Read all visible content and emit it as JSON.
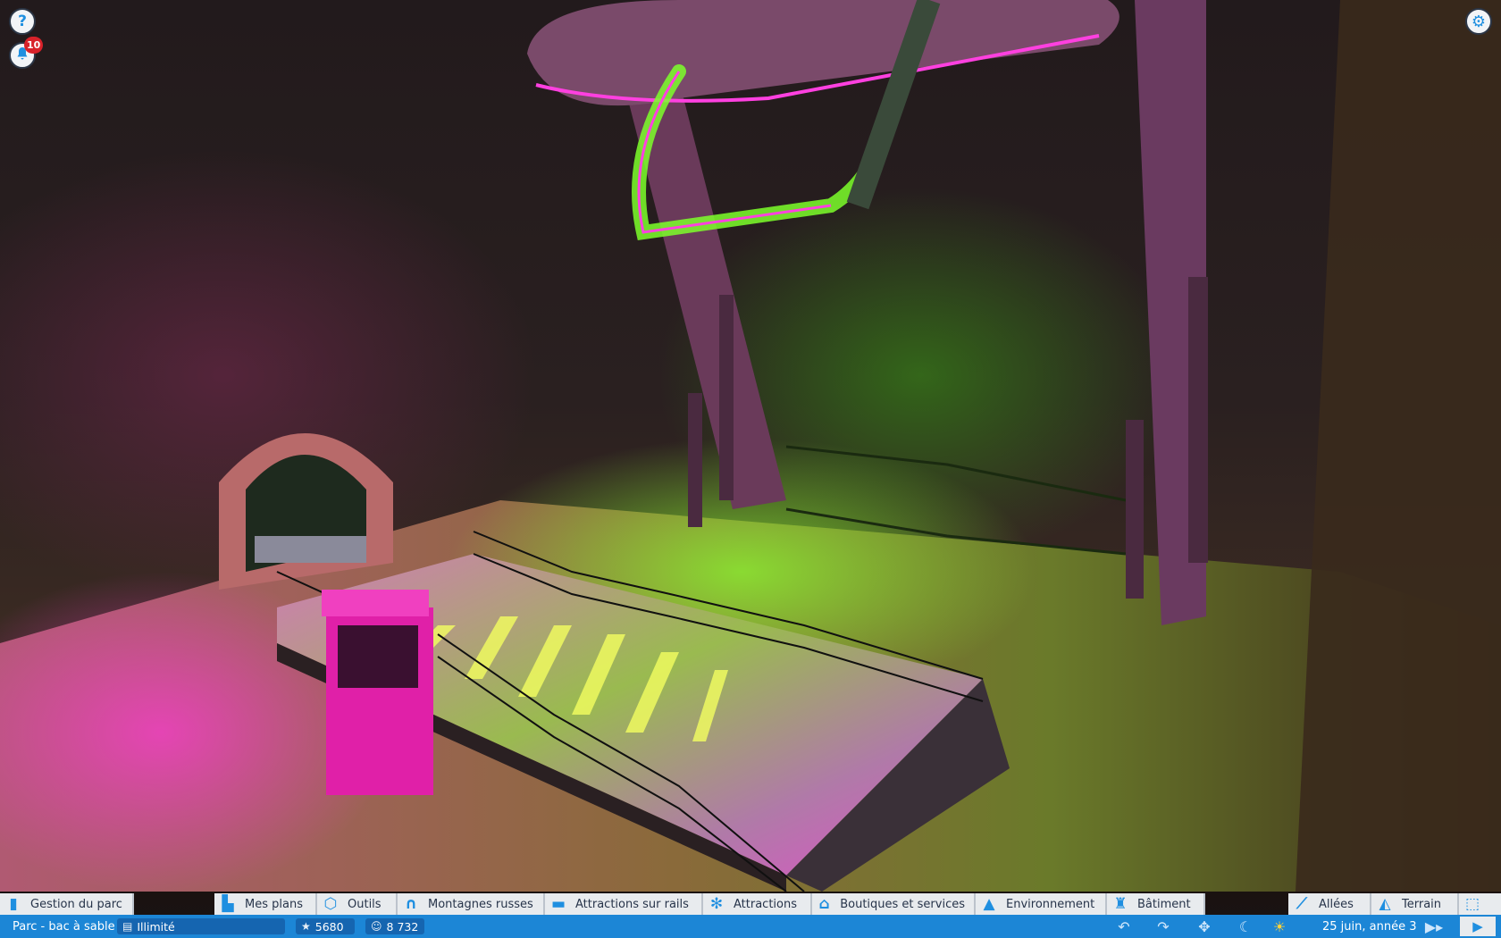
{
  "hud": {
    "help_icon": "question-icon",
    "notifications_icon": "bell-icon",
    "notification_count": "10",
    "settings_icon": "gear-icon"
  },
  "toolbar": {
    "park_management": "Gestion du parc",
    "blueprints": "Mes plans",
    "tools": "Outils",
    "coasters": "Montagnes russes",
    "track_rides": "Attractions sur rails",
    "flat_rides": "Attractions",
    "shops": "Boutiques et services",
    "scenery": "Environnement",
    "building": "Bâtiment",
    "paths": "Allées",
    "terrain": "Terrain"
  },
  "status": {
    "park_name": "Parc - bac à sable",
    "money": "Illimité",
    "rating": "5680",
    "guests": "8 732",
    "date": "25 juin, année 3"
  },
  "colors": {
    "toolbar_bg": "#e8ebee",
    "status_bg": "#1c86d6",
    "accent": "#1f8fe0",
    "badge": "#d8222a",
    "neon_green": "#7cff2a",
    "neon_magenta": "#ff2fd0"
  }
}
